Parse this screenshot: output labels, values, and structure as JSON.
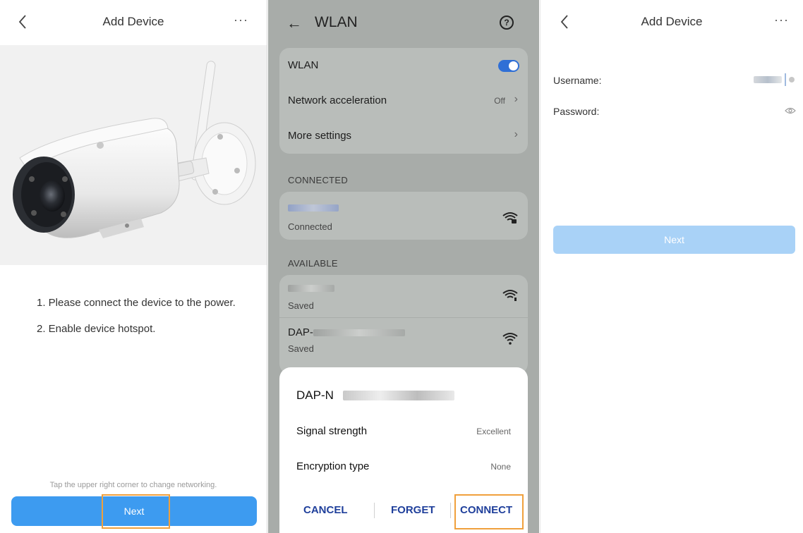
{
  "screen1": {
    "title": "Add Device",
    "more": "···",
    "steps": [
      "1. Please connect the device to the power.",
      "2. Enable device hotspot."
    ],
    "hint": "Tap the upper right corner to change networking.",
    "next_label": "Next",
    "icons": [
      "back-chevron-icon",
      "more-icon",
      "camera-image"
    ]
  },
  "screen2": {
    "title": "WLAN",
    "help": "?",
    "settings": [
      {
        "label": "WLAN",
        "value": "",
        "toggle": "on"
      },
      {
        "label": "Network acceleration",
        "value": "Off"
      },
      {
        "label": "More settings",
        "value": ""
      }
    ],
    "connected_header": "CONNECTED",
    "connected_status": "Connected",
    "available_header": "AVAILABLE",
    "available": [
      {
        "name": "",
        "status": "Saved"
      },
      {
        "name": "DAP-",
        "status": "Saved"
      }
    ],
    "dialog": {
      "title": "DAP-N",
      "rows": [
        {
          "label": "Signal strength",
          "value": "Excellent"
        },
        {
          "label": "Encryption type",
          "value": "None"
        }
      ],
      "cancel": "CANCEL",
      "forget": "FORGET",
      "connect": "CONNECT"
    },
    "accent": "#2f6fd6",
    "highlight_color": "#f0a03c"
  },
  "screen3": {
    "title": "Add Device",
    "more": "···",
    "username_label": "Username:",
    "password_label": "Password:",
    "next_label": "Next"
  }
}
